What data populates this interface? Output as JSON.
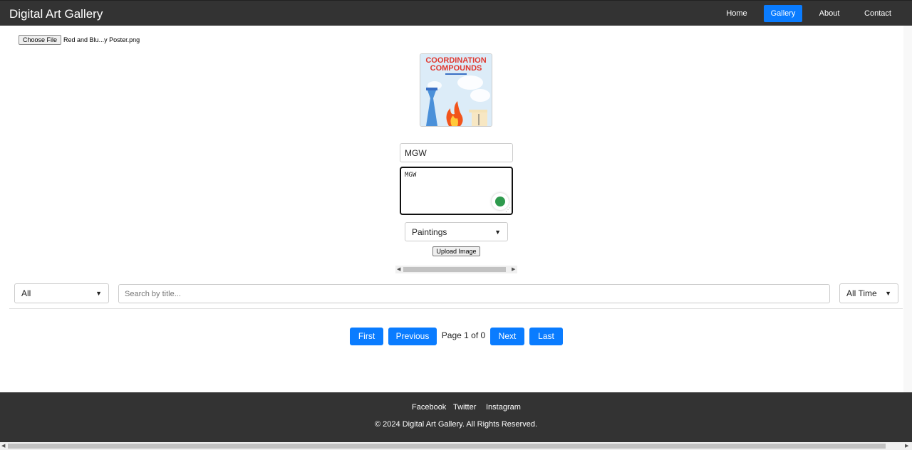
{
  "nav": {
    "brand": "Digital Art Gallery",
    "items": [
      {
        "label": "Home",
        "active": false
      },
      {
        "label": "Gallery",
        "active": true
      },
      {
        "label": "About",
        "active": false
      },
      {
        "label": "Contact",
        "active": false
      }
    ]
  },
  "upload": {
    "choose_file_label": "Choose File",
    "file_name": "Red and Blu...y Poster.png",
    "preview": {
      "heading_line1": "COORDINATION",
      "heading_line2": "COMPOUNDS"
    },
    "title_value": "MGW",
    "description_value": "MGW",
    "category_selected": "Paintings",
    "upload_button_label": "Upload Image"
  },
  "filters": {
    "category_selected": "All",
    "search_placeholder": "Search by title...",
    "time_selected": "All Time"
  },
  "pagination": {
    "first_label": "First",
    "previous_label": "Previous",
    "page_info": "Page 1 of 0",
    "next_label": "Next",
    "last_label": "Last"
  },
  "footer": {
    "links": [
      "Facebook",
      "Twitter",
      "Instagram"
    ],
    "copyright": "© 2024 Digital Art Gallery. All Rights Reserved."
  },
  "colors": {
    "navbar_bg": "#333333",
    "accent": "#0a7cff",
    "footer_bg": "#333333"
  },
  "icons": {
    "select_chevron": "chevron-down-icon",
    "grammar_assistant": "grammar-assistant-icon",
    "scroll_left": "scroll-left-arrow-icon",
    "scroll_right": "scroll-right-arrow-icon"
  }
}
